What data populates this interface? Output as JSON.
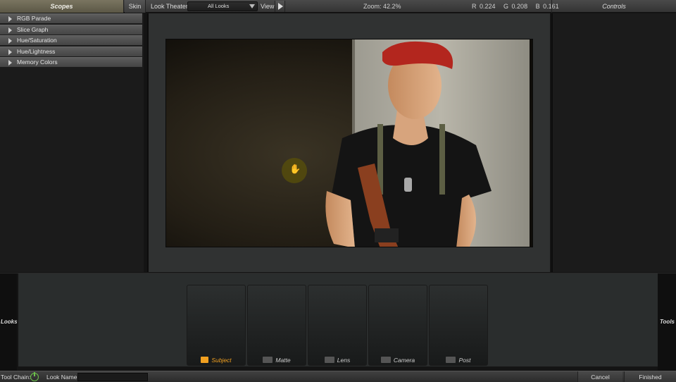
{
  "header": {
    "scopes_tab": "Scopes",
    "skin_tab": "Skin",
    "look_theater_label": "Look Theater",
    "looks_select_value": "All Looks",
    "view_label": "View",
    "zoom_label": "Zoom:",
    "zoom_value": "42.2%",
    "readout": {
      "r": "R 0.224",
      "g": "G 0.208",
      "b": "B 0.161"
    },
    "controls_tab": "Controls"
  },
  "scopes": {
    "items": [
      {
        "label": "RGB Parade"
      },
      {
        "label": "Slice Graph"
      },
      {
        "label": "Hue/Saturation"
      },
      {
        "label": "Hue/Lightness"
      },
      {
        "label": "Memory Colors"
      }
    ]
  },
  "side_labels": {
    "looks": "Looks",
    "tools": "Tools"
  },
  "tool_chain": {
    "cards": [
      {
        "label": "Subject",
        "active": true,
        "icon": "subject-icon"
      },
      {
        "label": "Matte",
        "active": false,
        "icon": "matte-camera-icon"
      },
      {
        "label": "Lens",
        "active": false,
        "icon": "lens-camera-icon"
      },
      {
        "label": "Camera",
        "active": false,
        "icon": "camera-icon"
      },
      {
        "label": "Post",
        "active": false,
        "icon": "post-icon"
      }
    ]
  },
  "statusbar": {
    "tool_chain_label": "Tool Chain:",
    "look_name_label": "Look Name:",
    "look_name_value": "",
    "cancel_label": "Cancel",
    "finished_label": "Finished"
  },
  "colors": {
    "accent_active": "#f1a020",
    "power_on": "#6cc24a",
    "scopes_tab_bg": "#6a6553"
  }
}
